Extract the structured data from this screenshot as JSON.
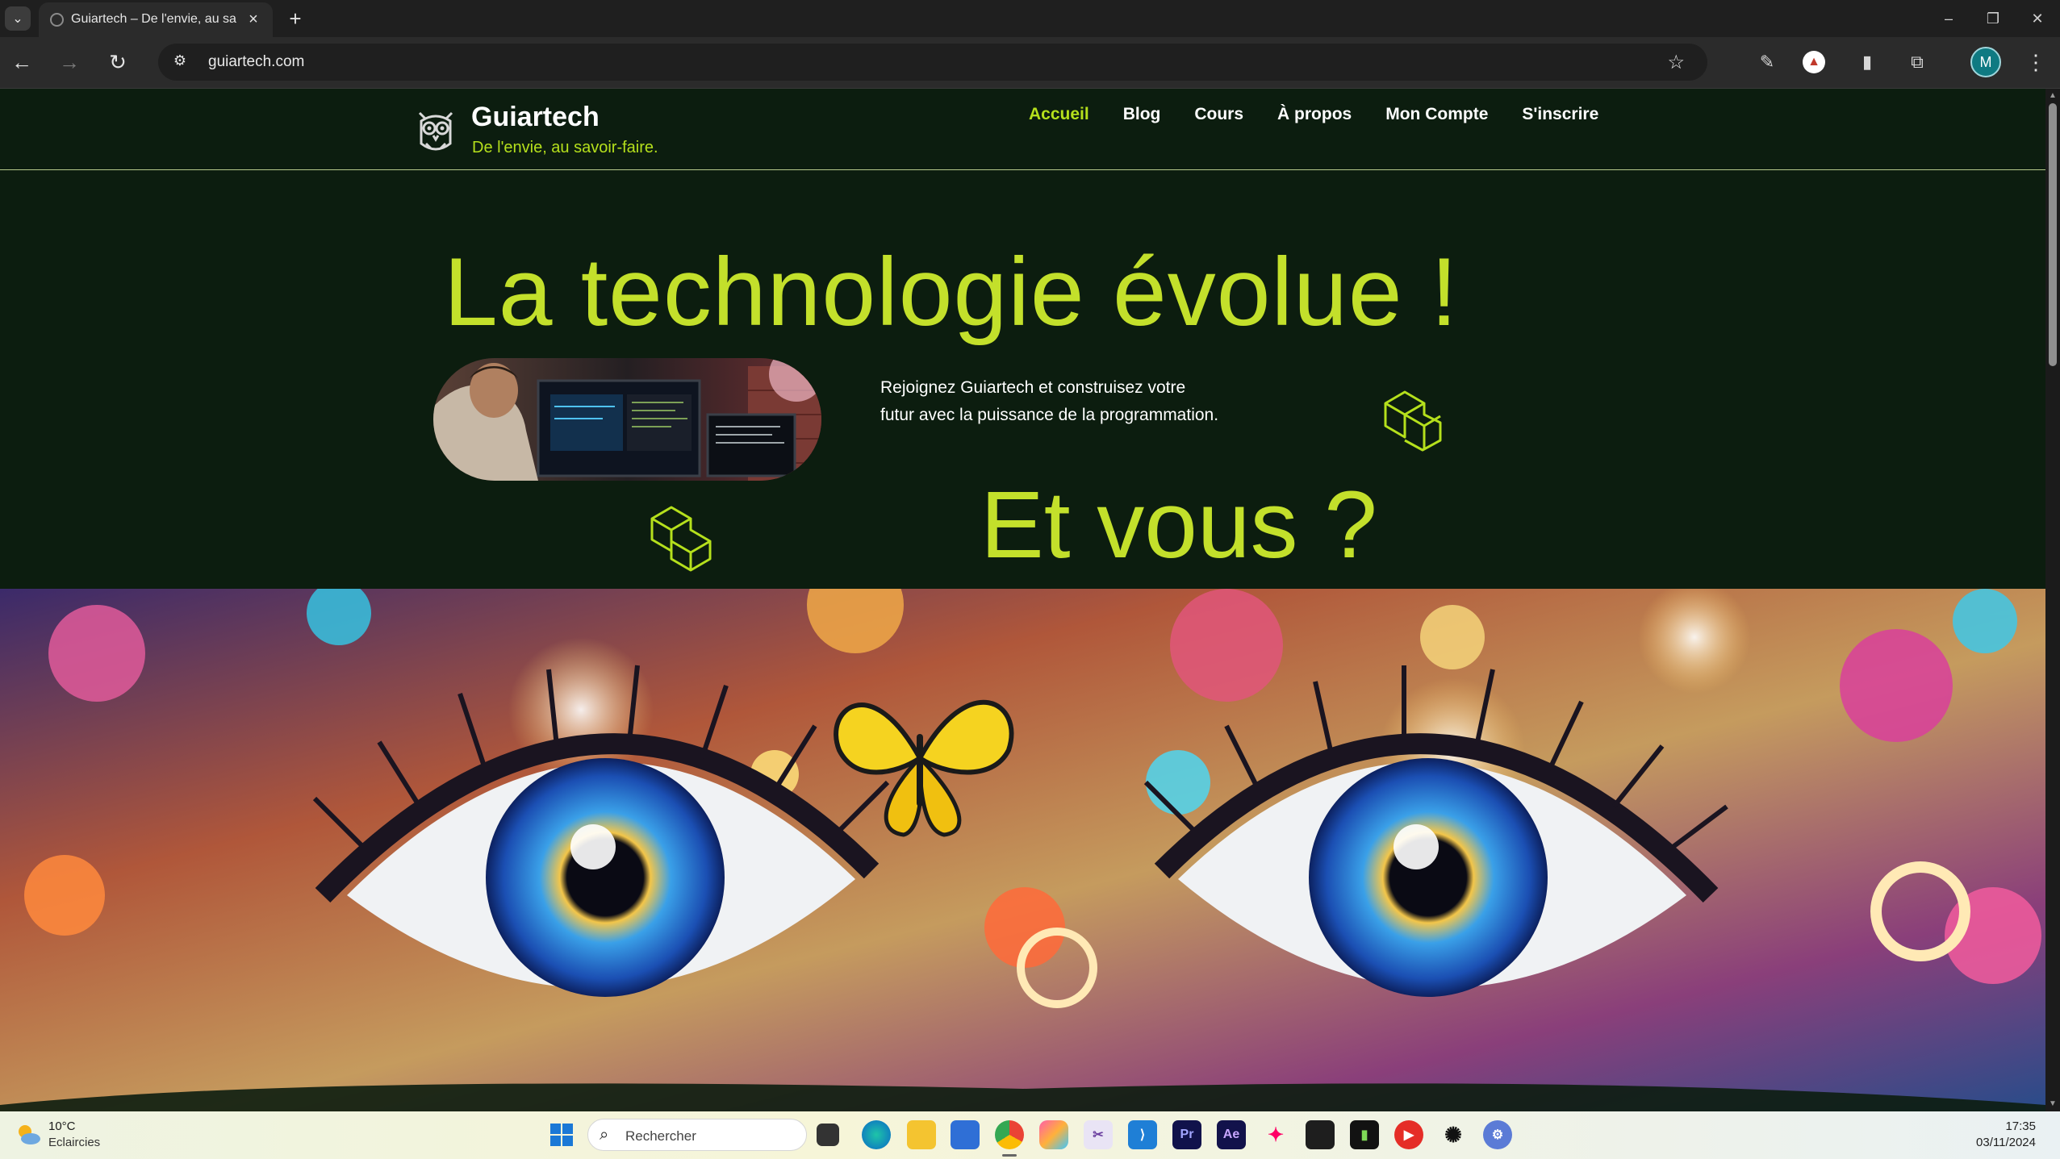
{
  "browser": {
    "tab_title": "Guiartech – De l'envie, au savoir-faire.",
    "url": "guiartech.com",
    "profile_initial": "M"
  },
  "site": {
    "title": "Guiartech",
    "tagline": "De l'envie, au savoir-faire.",
    "nav": [
      {
        "label": "Accueil",
        "active": true
      },
      {
        "label": "Blog"
      },
      {
        "label": "Cours"
      },
      {
        "label": "À propos"
      },
      {
        "label": "Mon Compte"
      },
      {
        "label": "S'inscrire"
      }
    ],
    "accent_color": "#b5e01c",
    "background_color": "#0c1d0f"
  },
  "hero": {
    "title": "La technologie évolue !",
    "text": "Rejoignez Guiartech et construisez votre futur avec la puissance de la programmation.",
    "subtitle": "Et vous ?"
  },
  "taskbar": {
    "weather_temp": "10°C",
    "weather_desc": "Eclaircies",
    "search_placeholder": "Rechercher",
    "time": "17:35",
    "date": "03/11/2024",
    "app_labels": {
      "premiere": "Pr",
      "after_effects": "Ae"
    }
  }
}
